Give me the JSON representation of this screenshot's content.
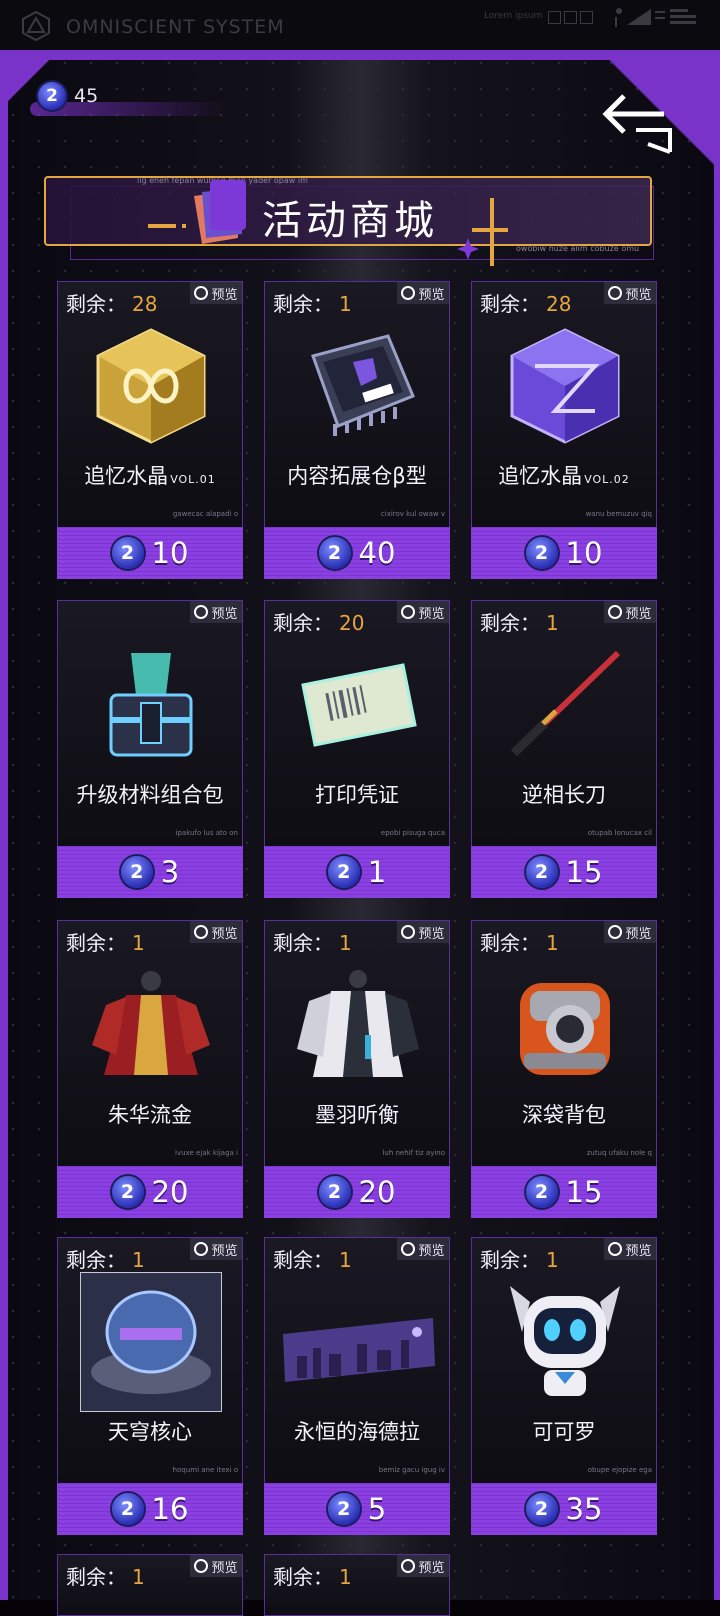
{
  "topbar": {
    "title": "OMNISCIENT SYSTEM",
    "subtitle": "Lorem ipsum"
  },
  "header": {
    "currency_icon": "coin-2-icon",
    "balance": "45",
    "title": "活动商城",
    "tiny_text_top": "lig eheh fepan wumsq man yader opaw im",
    "tiny_text_bottom": "owobiw huze alim cobuze omu"
  },
  "labels": {
    "remain": "剩余：",
    "preview": "预览",
    "coin_glyph": "2"
  },
  "items": [
    {
      "remain": "28",
      "name": "追忆水晶",
      "suffix": "VOL.01",
      "price": "10",
      "tiny": "gawecac alapadi o",
      "icon": "gold-crystal-icon"
    },
    {
      "remain": "1",
      "name": "内容拓展仓β型",
      "suffix": "",
      "price": "40",
      "tiny": "cixirov kul owaw v",
      "icon": "chip-mkb-icon"
    },
    {
      "remain": "28",
      "name": "追忆水晶",
      "suffix": "VOL.02",
      "price": "10",
      "tiny": "wanu bemuzuv qiq",
      "icon": "purple-crystal-icon"
    },
    {
      "remain": "",
      "name": "升级材料组合包",
      "suffix": "",
      "price": "3",
      "tiny": "ipakufo lus ato on",
      "icon": "material-box-icon"
    },
    {
      "remain": "20",
      "name": "打印凭证",
      "suffix": "",
      "price": "1",
      "tiny": "epobi pisuga quca",
      "icon": "print-ticket-icon"
    },
    {
      "remain": "1",
      "name": "逆相长刀",
      "suffix": "",
      "price": "15",
      "tiny": "otupab lonucax cil",
      "icon": "katana-icon"
    },
    {
      "remain": "1",
      "name": "朱华流金",
      "suffix": "",
      "price": "20",
      "tiny": "ivuxe ejak kijaga i",
      "icon": "red-outfit-icon"
    },
    {
      "remain": "1",
      "name": "墨羽听衡",
      "suffix": "",
      "price": "20",
      "tiny": "luh nehif tiz ayino",
      "icon": "white-outfit-icon"
    },
    {
      "remain": "1",
      "name": "深袋背包",
      "suffix": "",
      "price": "15",
      "tiny": "zutuq ufaku nole q",
      "icon": "backpack-icon"
    },
    {
      "remain": "1",
      "name": "天穹核心",
      "suffix": "",
      "price": "16",
      "tiny": "hoqumi ane itexi o",
      "icon": "dome-core-icon"
    },
    {
      "remain": "1",
      "name": "永恒的海德拉",
      "suffix": "",
      "price": "5",
      "tiny": "bemiz gacu igug iv",
      "icon": "city-banner-icon"
    },
    {
      "remain": "1",
      "name": "可可罗",
      "suffix": "",
      "price": "35",
      "tiny": "obupe ejopize ega",
      "icon": "robot-icon"
    },
    {
      "remain": "1",
      "name": "",
      "suffix": "",
      "price": "",
      "tiny": "",
      "icon": ""
    },
    {
      "remain": "1",
      "name": "",
      "suffix": "",
      "price": "",
      "tiny": "",
      "icon": ""
    }
  ],
  "colors": {
    "accent": "#7a33c8",
    "gold": "#e5a640",
    "price_bar": "#8a3fe0"
  }
}
